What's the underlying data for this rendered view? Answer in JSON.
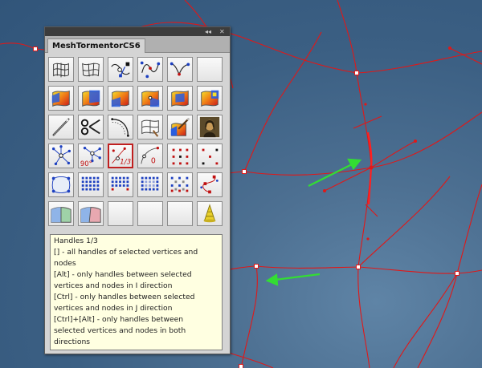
{
  "panel": {
    "title": "MeshTormentorCS6",
    "collapse_icon": "double-chevron-left-icon",
    "close_icon": "close-icon",
    "collapse_glyph": "◂◂",
    "close_glyph": "✕"
  },
  "tool_grid": {
    "rows": [
      [
        "mesh-warp-icon",
        "mesh-warp-alt-icon",
        "select-path-icon",
        "path-node-icon",
        "path-curve-icon",
        "empty-button"
      ],
      [
        "gradient-mesh-icon",
        "gradient-mesh-blue-icon",
        "gradient-mesh-select-icon",
        "gradient-mesh-point-icon",
        "gradient-mesh-multi-icon",
        "gradient-mesh-color-icon"
      ],
      [
        "needle-icon",
        "scissors-icon",
        "curve-dotted-icon",
        "mesh-paint-icon",
        "mesh-brush-icon",
        "mona-lisa-icon"
      ],
      [
        "handles-star-icon",
        "handles-90-icon",
        "handles-one-third-icon",
        "handles-zero-icon",
        "handle-dots-grid-icon",
        "handle-dots-sparse-icon"
      ],
      [
        "mesh-rect-icon",
        "blue-dot-grid-icon",
        "blue-dot-grid-2-icon",
        "blue-dot-grid-3-icon",
        "mixed-dot-grid-icon",
        "dot-path-icon"
      ],
      [
        "mesh-band-icon",
        "mesh-band-2-icon",
        "empty-button",
        "empty-button",
        "empty-button",
        "cone-icon"
      ]
    ],
    "selected": "handles-one-third-icon",
    "handle_label_90": "90°",
    "handle_label_third": "1/3",
    "handle_label_zero": "0"
  },
  "tooltip": {
    "lines": [
      "Handles 1/3",
      "[] - all handles of selected vertices and",
      "nodes",
      "[Alt] - only handles between selected",
      "vertices and nodes in I direction",
      "[Ctrl] - only handles between selected",
      "vertices and nodes in J direction",
      "[Ctrl]+[Alt] - only handles between",
      "selected vertices and nodes in both",
      "directions"
    ]
  },
  "colors": {
    "mesh_line": "#e01818",
    "arrow": "#33dd33",
    "background": "#3b5f83"
  }
}
